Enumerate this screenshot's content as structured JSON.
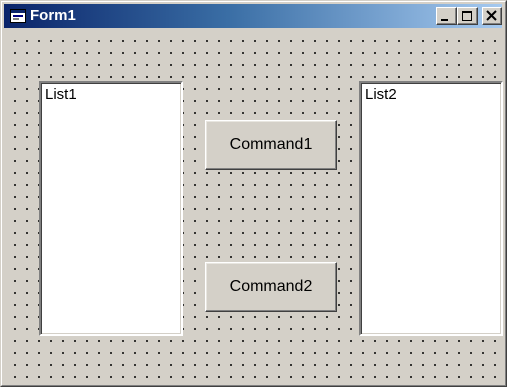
{
  "window": {
    "title": "Form1",
    "accent_color": "#0a246a",
    "face_color": "#d4d0c8"
  },
  "titlebar": {
    "icon": "form-icon",
    "controls": [
      "minimize-icon",
      "maximize-icon",
      "close-icon"
    ]
  },
  "form": {
    "list1": {
      "text": "List1"
    },
    "list2": {
      "text": "List2"
    },
    "command1": {
      "label": "Command1"
    },
    "command2": {
      "label": "Command2"
    }
  }
}
